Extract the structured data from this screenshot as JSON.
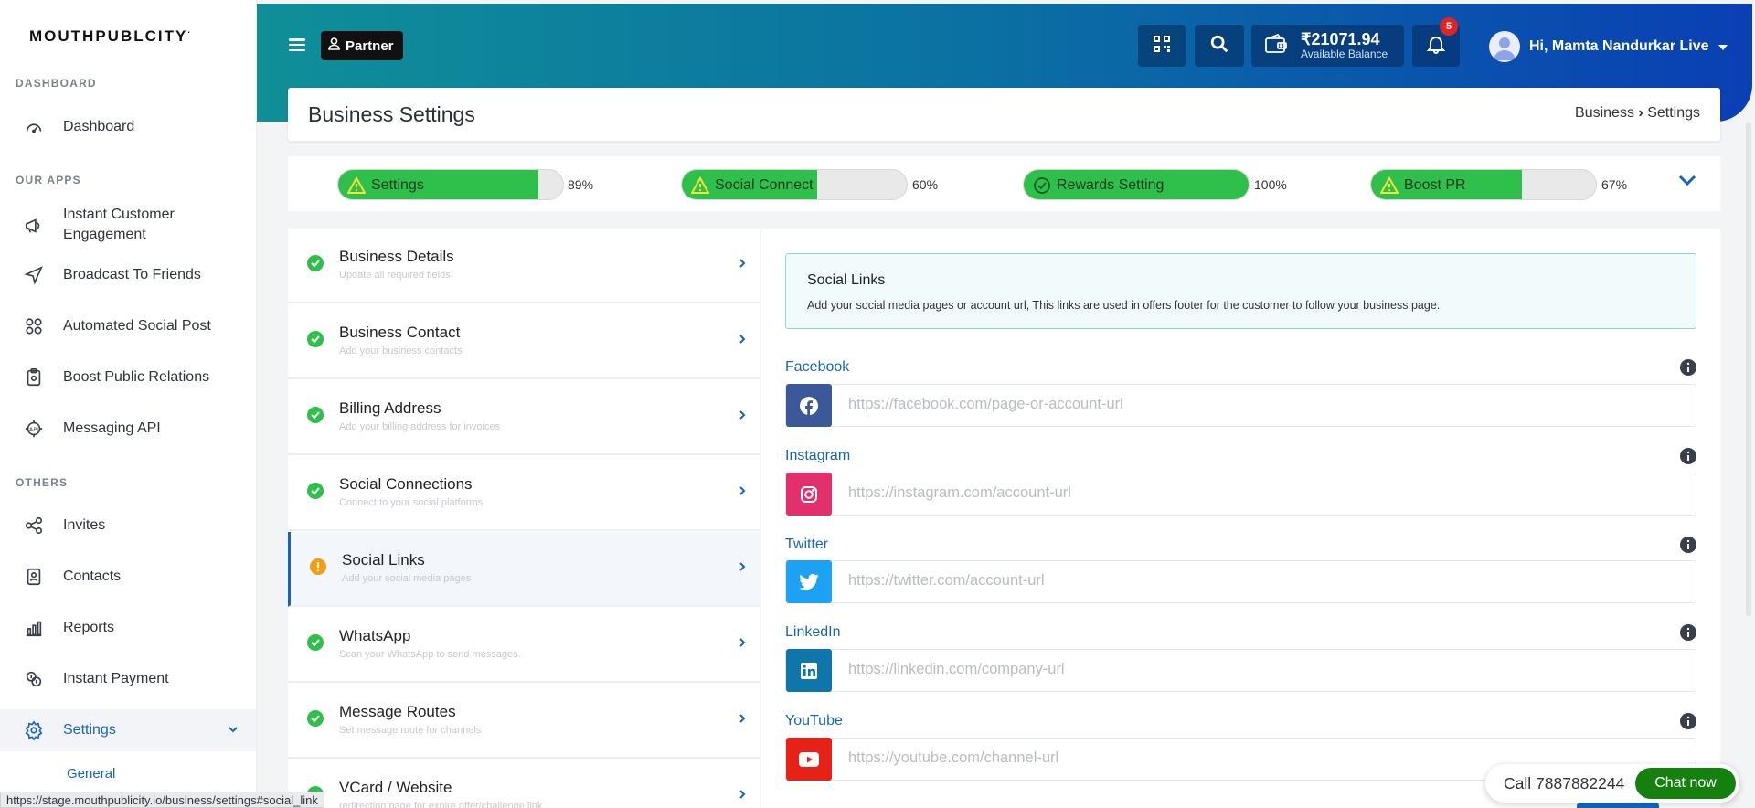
{
  "sidebar": {
    "brand": "MOUTHPUBLCITY",
    "brand_mark": "·",
    "section_dashboard": "DASHBOARD",
    "section_apps": "OUR APPS",
    "section_others": "OTHERS",
    "items": [
      {
        "label": "Dashboard"
      },
      {
        "label": "Instant Customer Engagement"
      },
      {
        "label": "Broadcast To Friends"
      },
      {
        "label": "Automated Social Post"
      },
      {
        "label": "Boost Public Relations"
      },
      {
        "label": "Messaging API"
      },
      {
        "label": "Invites"
      },
      {
        "label": "Contacts"
      },
      {
        "label": "Reports"
      },
      {
        "label": "Instant Payment"
      },
      {
        "label": "Settings"
      }
    ],
    "sub_item": "General"
  },
  "header": {
    "partner_label": "Partner",
    "wallet_amount": "₹21071.94",
    "wallet_sub": "Available Balance",
    "notification_count": "5",
    "user_greeting": "Hi, Mamta Nandurkar Live"
  },
  "titlebar": {
    "title": "Business Settings",
    "crumb_parent": "Business",
    "crumb_sep": "›",
    "crumb_current": "Settings"
  },
  "progress": [
    {
      "label": "Settings",
      "percent": 89,
      "percent_text": "89%",
      "status": "warning"
    },
    {
      "label": "Social Connect",
      "percent": 60,
      "percent_text": "60%",
      "status": "warning"
    },
    {
      "label": "Rewards Setting",
      "percent": 100,
      "percent_text": "100%",
      "status": "complete"
    },
    {
      "label": "Boost PR",
      "percent": 67,
      "percent_text": "67%",
      "status": "warning"
    }
  ],
  "settings_menu": [
    {
      "title": "Business Details",
      "subtitle": "Update all required fields",
      "status": "complete"
    },
    {
      "title": "Business Contact",
      "subtitle": "Add your business contacts",
      "status": "complete"
    },
    {
      "title": "Billing Address",
      "subtitle": "Add your billing address for invoices",
      "status": "complete"
    },
    {
      "title": "Social Connections",
      "subtitle": "Connect to your social platforms",
      "status": "complete"
    },
    {
      "title": "Social Links",
      "subtitle": "Add your social media pages",
      "status": "pending"
    },
    {
      "title": "WhatsApp",
      "subtitle": "Scan your WhatsApp to send messages.",
      "status": "complete"
    },
    {
      "title": "Message Routes",
      "subtitle": "Set message route for channels",
      "status": "complete"
    },
    {
      "title": "VCard / Website",
      "subtitle": "redirection page for expire offer/challenge link",
      "status": "complete"
    }
  ],
  "panel": {
    "info_title": "Social Links",
    "info_text": "Add your social media pages or account url, This links are used in offers footer for the customer to follow your business page.",
    "fields": [
      {
        "label": "Facebook",
        "placeholder": "https://facebook.com/page-or-account-url",
        "value": "",
        "color": "#3b5998",
        "icon": "facebook-icon"
      },
      {
        "label": "Instagram",
        "placeholder": "https://instagram.com/account-url",
        "value": "",
        "color": "#e1306c",
        "icon": "instagram-icon"
      },
      {
        "label": "Twitter",
        "placeholder": "https://twitter.com/account-url",
        "value": "",
        "color": "#1da1f2",
        "icon": "twitter-icon"
      },
      {
        "label": "LinkedIn",
        "placeholder": "https://linkedin.com/company-url",
        "value": "",
        "color": "#0e76a8",
        "icon": "linkedin-icon"
      },
      {
        "label": "YouTube",
        "placeholder": "https://youtube.com/channel-url",
        "value": "",
        "color": "#e62117",
        "icon": "youtube-icon"
      }
    ]
  },
  "chat": {
    "call_text": "Call 7887882244",
    "button_label": "Chat now"
  },
  "status_url": "https://stage.mouthpublicity.io/business/settings#social_link",
  "colors": {
    "accent": "#1565c0",
    "progress_green": "#2fbf4b",
    "warning_yellow": "#f5c518",
    "pending_orange": "#f39c12",
    "chat_green": "#14810f"
  }
}
